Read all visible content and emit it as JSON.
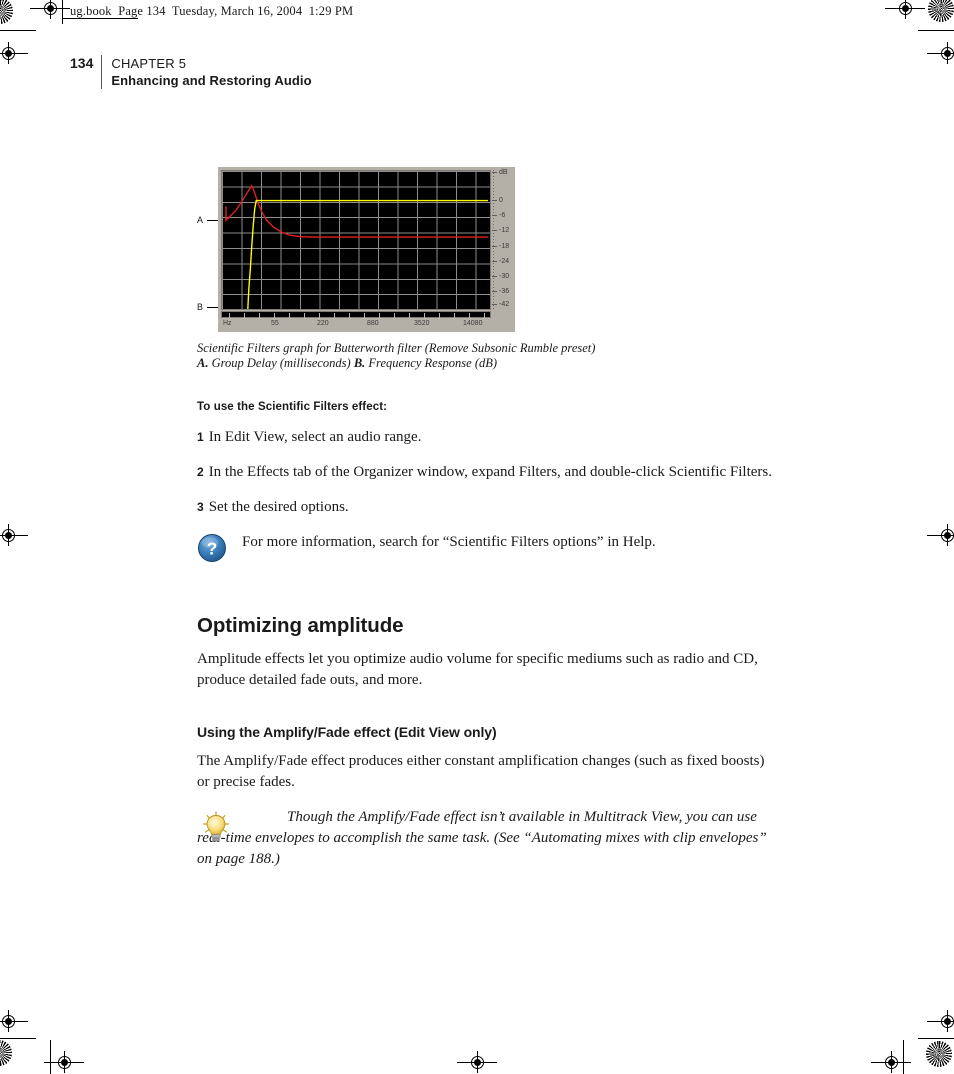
{
  "slug": {
    "text": "ug.book  Page 134  Tuesday, March 16, 2004  1:29 PM"
  },
  "running_head": {
    "folio": "134",
    "chapter": "CHAPTER 5",
    "title": "Enhancing and Restoring Audio"
  },
  "figure": {
    "callout_a": "A",
    "callout_b": "B",
    "caption_line1": "Scientific Filters graph for Butterworth filter (Remove Subsonic Rumble preset)",
    "caption_a_label": "A.",
    "caption_a_text": " Group Delay (milliseconds)  ",
    "caption_b_label": "B.",
    "caption_b_text": " Frequency Response (dB)",
    "colors": {
      "group_delay": "#ffff00",
      "frequency_response": "#e02020",
      "plot_background": "#000000",
      "grid": "#8d8d8d",
      "panel": "#b4b0a8"
    }
  },
  "chart_data": {
    "type": "line",
    "title": "Scientific Filters graph for Butterworth filter (Remove Subsonic Rumble preset)",
    "xlabel": "Hz",
    "ylabel": "dB",
    "x_scale": "log",
    "xlim": [
      20,
      22050
    ],
    "ylim": [
      -48,
      6
    ],
    "xticks": [
      "Hz",
      "55",
      "220",
      "880",
      "3520",
      "14080"
    ],
    "yticks": [
      "dB",
      "0",
      "-6",
      "-12",
      "-18",
      "-24",
      "-30",
      "-36",
      "-42"
    ],
    "grid": true,
    "legend": "none",
    "series": [
      {
        "name": "Group Delay (milliseconds)",
        "color": "#ffff00",
        "points": [
          [
            22,
            -48
          ],
          [
            26,
            -38
          ],
          [
            30,
            -26
          ],
          [
            34,
            -14
          ],
          [
            38,
            -4
          ],
          [
            41,
            0
          ],
          [
            55,
            0
          ],
          [
            110,
            0
          ],
          [
            220,
            0
          ],
          [
            880,
            0
          ],
          [
            3520,
            0
          ],
          [
            14080,
            0
          ],
          [
            22050,
            0
          ]
        ]
      },
      {
        "name": "Frequency Response (dB)",
        "color": "#e02020",
        "points": [
          [
            20,
            -8
          ],
          [
            24,
            -7.5
          ],
          [
            28,
            -6.5
          ],
          [
            32,
            -4.5
          ],
          [
            36,
            -1.5
          ],
          [
            39,
            1.5
          ],
          [
            41,
            3.2
          ],
          [
            43,
            1.0
          ],
          [
            46,
            -2.5
          ],
          [
            52,
            -6.5
          ],
          [
            62,
            -10.5
          ],
          [
            80,
            -14
          ],
          [
            105,
            -16.5
          ],
          [
            140,
            -17.6
          ],
          [
            190,
            -18
          ],
          [
            400,
            -18
          ],
          [
            1000,
            -18
          ],
          [
            4000,
            -18
          ],
          [
            14080,
            -18
          ],
          [
            22050,
            -18
          ]
        ]
      }
    ]
  },
  "procedure": {
    "heading": "To use the Scientific Filters effect:",
    "steps": [
      {
        "num": "1",
        "text": "In Edit View, select an audio range."
      },
      {
        "num": "2",
        "text": "In the Effects tab of the Organizer window, expand Filters, and double-click Scientific Filters."
      },
      {
        "num": "3",
        "text": "Set the desired options."
      }
    ]
  },
  "help_note": {
    "icon": "help-question-icon",
    "text": "For more information, search for “Scientific Filters options” in Help."
  },
  "section": {
    "h1": "Optimizing amplitude",
    "intro": "Amplitude effects let you optimize audio volume for specific mediums such as radio and CD, produce detailed fade outs, and more.",
    "h2": "Using the Amplify/Fade effect (Edit View only)",
    "body": "The Amplify/Fade effect produces either constant amplification changes (such as fixed boosts) or precise fades."
  },
  "tip_note": {
    "icon": "lightbulb-tip-icon",
    "text": "Though the Amplify/Fade effect isn’t available in Multitrack View, you can use real-time envelopes to accomplish the same task. (See “Automating mixes with clip envelopes” on page 188.)"
  }
}
